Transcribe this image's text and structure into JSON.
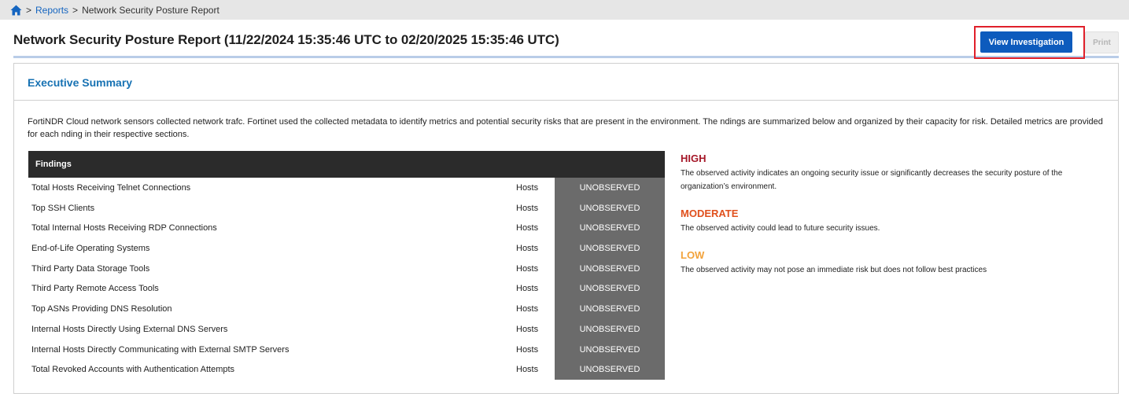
{
  "breadcrumb": {
    "home_icon": "home-icon",
    "separator": ">",
    "items": [
      "Reports",
      "Network Security Posture Report"
    ]
  },
  "header": {
    "title": "Network Security Posture Report (11/22/2024 15:35:46 UTC to 02/20/2025 15:35:46 UTC)",
    "view_investigation_label": "View Investigation",
    "print_label": "Print"
  },
  "summary": {
    "heading": "Executive Summary",
    "intro": "FortiNDR Cloud network sensors collected network trafc. Fortinet used the collected metadata to identify metrics and potential security risks that are present in the environment. The ndings are summarized below and organized by their capacity for risk. Detailed metrics are provided for each nding in their respective sections.",
    "findings_header": "Findings",
    "findings": [
      {
        "name": "Total Hosts Receiving Telnet Connections",
        "unit": "Hosts",
        "status": "UNOBSERVED"
      },
      {
        "name": "Top SSH Clients",
        "unit": "Hosts",
        "status": "UNOBSERVED"
      },
      {
        "name": "Total Internal Hosts Receiving RDP Connections",
        "unit": "Hosts",
        "status": "UNOBSERVED"
      },
      {
        "name": "End-of-Life Operating Systems",
        "unit": "Hosts",
        "status": "UNOBSERVED"
      },
      {
        "name": "Third Party Data Storage Tools",
        "unit": "Hosts",
        "status": "UNOBSERVED"
      },
      {
        "name": "Third Party Remote Access Tools",
        "unit": "Hosts",
        "status": "UNOBSERVED"
      },
      {
        "name": "Top ASNs Providing DNS Resolution",
        "unit": "Hosts",
        "status": "UNOBSERVED"
      },
      {
        "name": "Internal Hosts Directly Using External DNS Servers",
        "unit": "Hosts",
        "status": "UNOBSERVED"
      },
      {
        "name": "Internal Hosts Directly Communicating with External SMTP Servers",
        "unit": "Hosts",
        "status": "UNOBSERVED"
      },
      {
        "name": "Total Revoked Accounts with Authentication Attempts",
        "unit": "Hosts",
        "status": "UNOBSERVED"
      }
    ],
    "legend": {
      "high": {
        "title": "HIGH",
        "desc": "The observed activity indicates an ongoing security issue or significantly decreases the security posture of the organization’s environment."
      },
      "moderate": {
        "title": "MODERATE",
        "desc": "The observed activity could lead to future security issues."
      },
      "low": {
        "title": "LOW",
        "desc": "The observed activity may not pose an immediate risk but does not follow best practices"
      }
    }
  },
  "colors": {
    "accent": "#0d5bbd",
    "heading": "#1772b3",
    "high": "#a51728",
    "moderate": "#e0501d",
    "low": "#f2a23a",
    "status_bg": "#6b6b6b",
    "highlight": "#e0202a"
  }
}
